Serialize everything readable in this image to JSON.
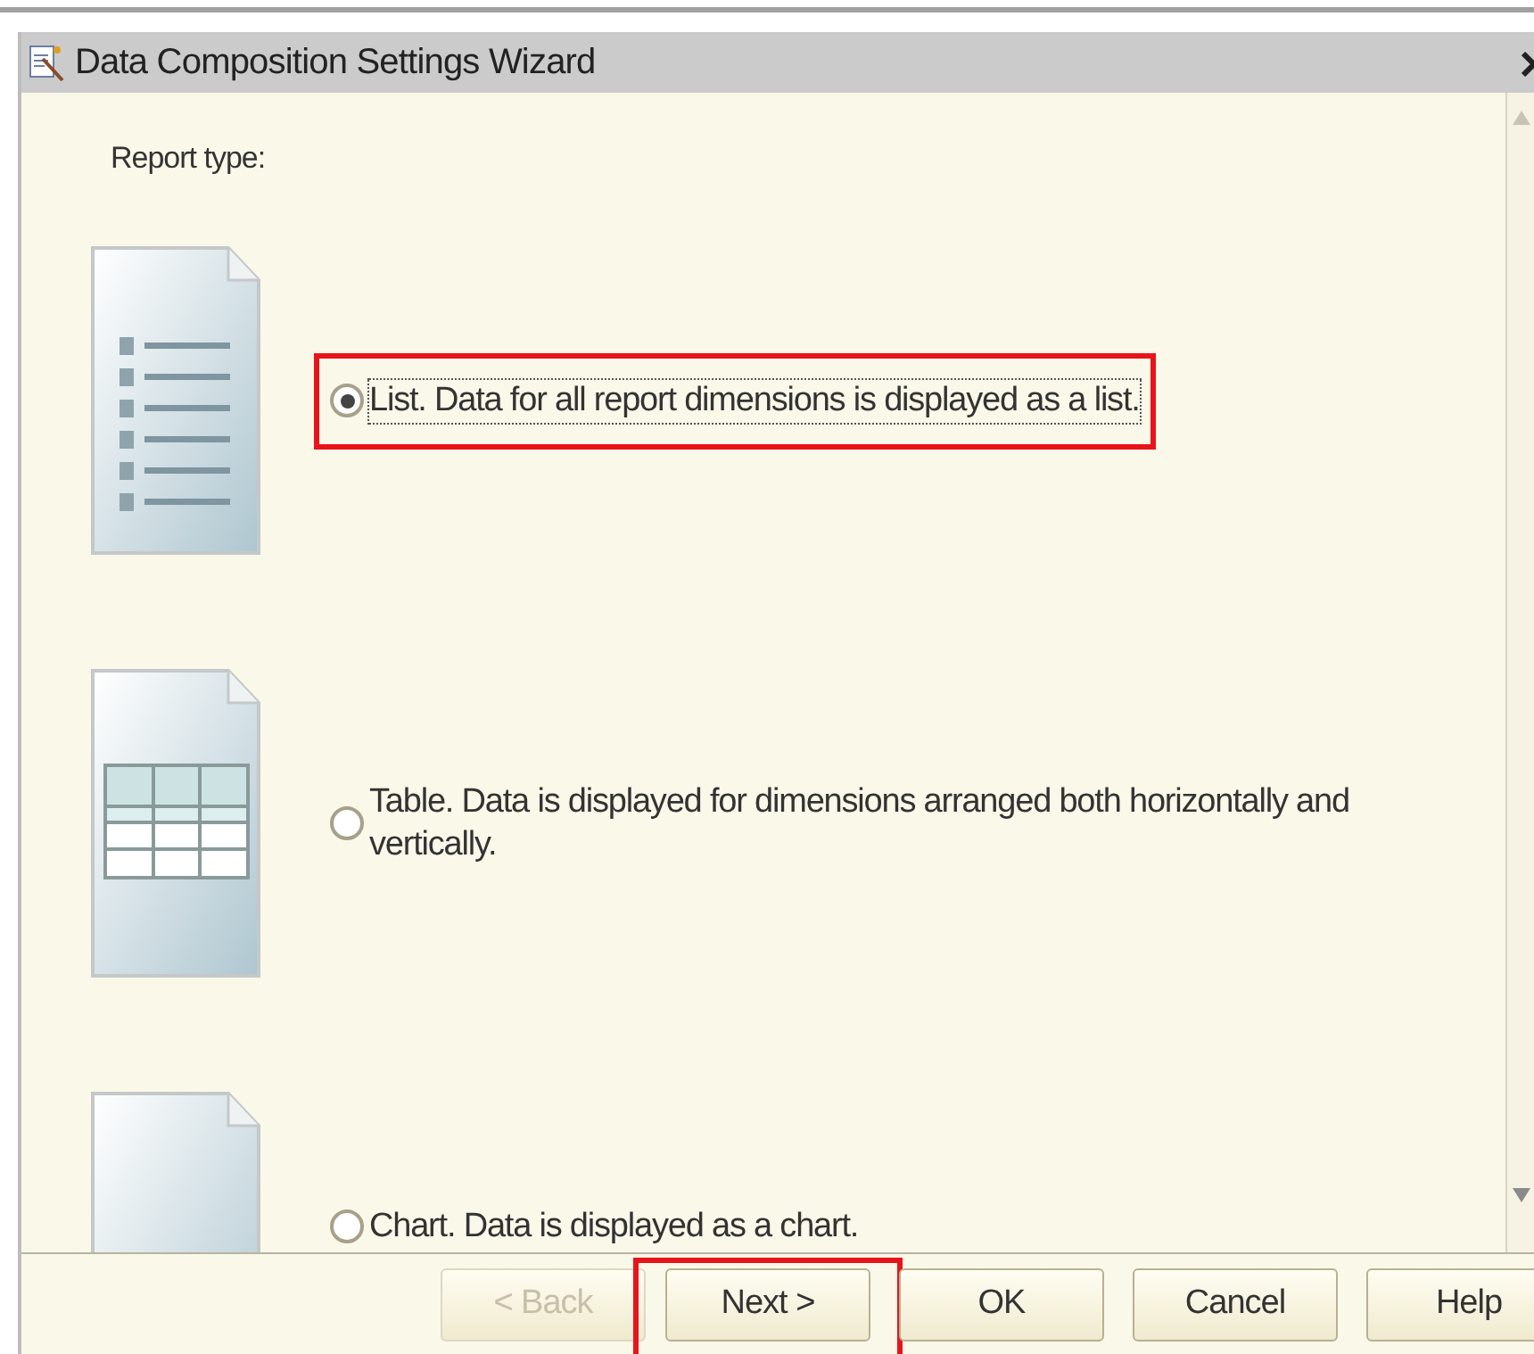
{
  "window": {
    "title": "Data Composition Settings Wizard"
  },
  "section_label": "Report type:",
  "options": [
    {
      "kind": "list",
      "label": "List. Data for all report dimensions is displayed as a list.",
      "selected": true,
      "highlighted": true
    },
    {
      "kind": "table",
      "label": "Table. Data is displayed for dimensions arranged both horizontally and vertically.",
      "selected": false,
      "highlighted": false
    },
    {
      "kind": "chart",
      "label": "Chart. Data is displayed as a chart.",
      "selected": false,
      "highlighted": false
    }
  ],
  "buttons": [
    {
      "label": "< Back",
      "disabled": true,
      "highlighted": false
    },
    {
      "label": "Next >",
      "disabled": false,
      "highlighted": true
    },
    {
      "label": "OK",
      "disabled": false,
      "highlighted": false
    },
    {
      "label": "Cancel",
      "disabled": false,
      "highlighted": false
    },
    {
      "label": "Help",
      "disabled": false,
      "highlighted": false
    }
  ]
}
